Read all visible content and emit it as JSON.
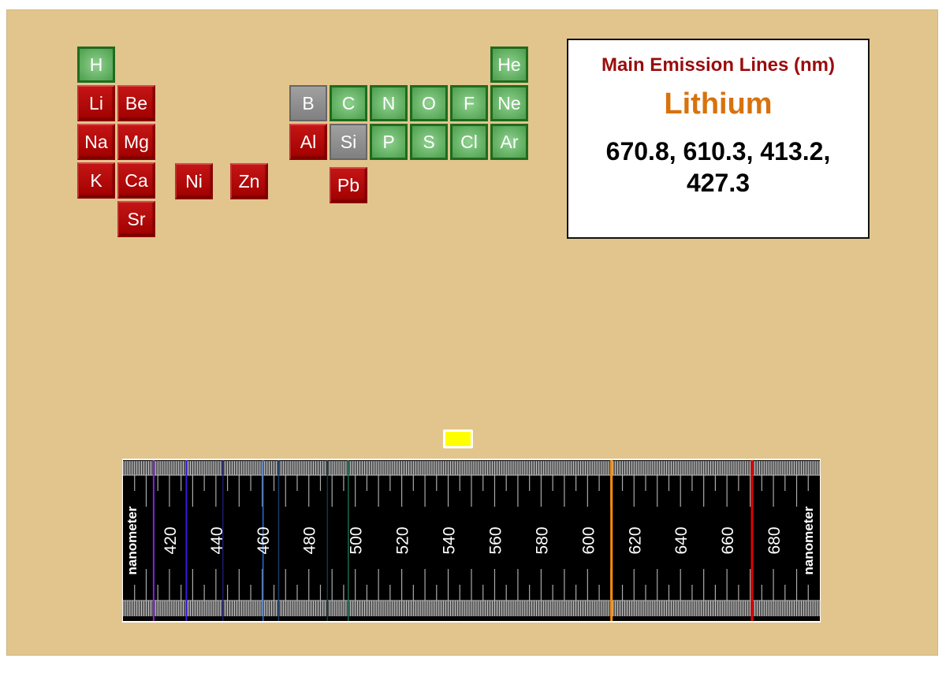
{
  "elements": [
    {
      "symbol": "H",
      "type": "green",
      "row": 0,
      "col": 0
    },
    {
      "symbol": "He",
      "type": "green",
      "row": 0,
      "col": "n"
    },
    {
      "symbol": "Li",
      "type": "red",
      "row": 1,
      "col": 0
    },
    {
      "symbol": "Be",
      "type": "red",
      "row": 1,
      "col": 1
    },
    {
      "symbol": "B",
      "type": "gray",
      "row": 1,
      "col": "B"
    },
    {
      "symbol": "C",
      "type": "green",
      "row": 1,
      "col": "C"
    },
    {
      "symbol": "N",
      "type": "green",
      "row": 1,
      "col": "N"
    },
    {
      "symbol": "O",
      "type": "green",
      "row": 1,
      "col": "O"
    },
    {
      "symbol": "F",
      "type": "green",
      "row": 1,
      "col": "F"
    },
    {
      "symbol": "Ne",
      "type": "green",
      "row": 1,
      "col": "n"
    },
    {
      "symbol": "Na",
      "type": "red",
      "row": 2,
      "col": 0
    },
    {
      "symbol": "Mg",
      "type": "red",
      "row": 2,
      "col": 1
    },
    {
      "symbol": "Al",
      "type": "red",
      "row": 2,
      "col": "B"
    },
    {
      "symbol": "Si",
      "type": "gray",
      "row": 2,
      "col": "C"
    },
    {
      "symbol": "P",
      "type": "green",
      "row": 2,
      "col": "N"
    },
    {
      "symbol": "S",
      "type": "green",
      "row": 2,
      "col": "O"
    },
    {
      "symbol": "Cl",
      "type": "green",
      "row": 2,
      "col": "F"
    },
    {
      "symbol": "Ar",
      "type": "green",
      "row": 2,
      "col": "n"
    },
    {
      "symbol": "K",
      "type": "red",
      "row": 3,
      "col": 0
    },
    {
      "symbol": "Ca",
      "type": "red",
      "row": 3,
      "col": 1
    },
    {
      "symbol": "Ni",
      "type": "red",
      "row": 3,
      "col": "Ni"
    },
    {
      "symbol": "Zn",
      "type": "red",
      "row": 3,
      "col": "Zn"
    },
    {
      "symbol": "Pb",
      "type": "red",
      "row": 3,
      "col": "Pb"
    },
    {
      "symbol": "Sr",
      "type": "red",
      "row": 4,
      "col": 1
    }
  ],
  "info": {
    "title": "Main Emission Lines (nm)",
    "element": "Lithium",
    "lines": "670.8, 610.3, 413.2, 427.3"
  },
  "swatch_color": "#ffff00",
  "spectrum": {
    "unit_label": "nanometer",
    "range": [
      400,
      700
    ],
    "tick_labels": [
      420,
      440,
      460,
      480,
      500,
      520,
      540,
      560,
      580,
      600,
      620,
      640,
      660,
      680
    ],
    "emission_lines": [
      {
        "nm": 413.2,
        "color": "#8a1fe0",
        "strong": false
      },
      {
        "nm": 427.3,
        "color": "#3a1ad6",
        "strong": false
      },
      {
        "nm": 610.3,
        "color": "#ff8c00",
        "strong": true
      },
      {
        "nm": 670.8,
        "color": "#e00000",
        "strong": true
      }
    ],
    "faint_lines": [
      {
        "nm": 443,
        "color": "#1a1a70"
      },
      {
        "nm": 460.3,
        "color": "#2a6ae0"
      },
      {
        "nm": 467,
        "color": "#1a3a6a"
      },
      {
        "nm": 488,
        "color": "#103a3a"
      },
      {
        "nm": 497,
        "color": "#1a6a4a"
      }
    ]
  }
}
